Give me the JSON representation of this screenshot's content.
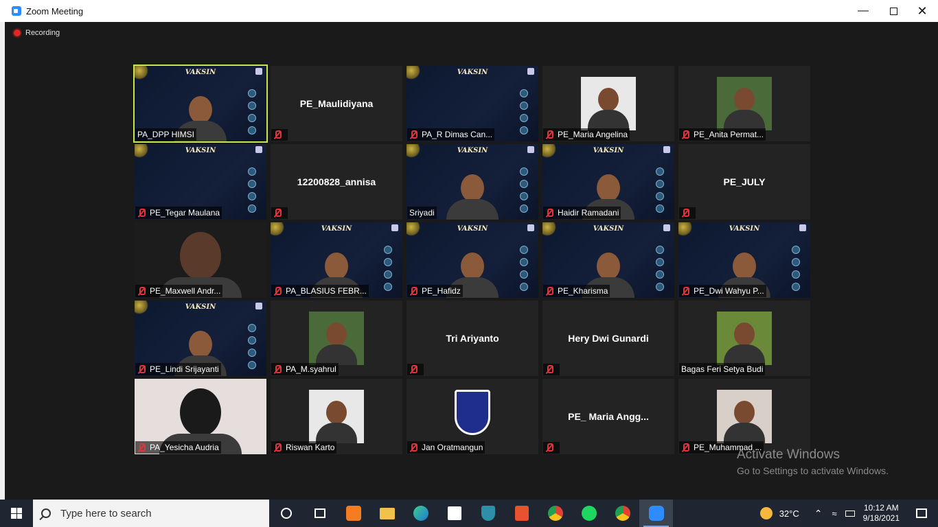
{
  "window": {
    "title": "Zoom Meeting"
  },
  "recording": {
    "label": "Recording"
  },
  "participants": [
    {
      "name": "PA_DPP HIMSI",
      "type": "slide-video",
      "muted": false,
      "active": true
    },
    {
      "name": "PE_Maulidiyana",
      "type": "name-only",
      "muted": true
    },
    {
      "name": "PA_R Dimas Can...",
      "type": "slide",
      "muted": true
    },
    {
      "name": "PE_Maria Angelina",
      "type": "photo",
      "muted": true
    },
    {
      "name": "PE_Anita Permat...",
      "type": "photo",
      "muted": true
    },
    {
      "name": "PE_Tegar Maulana",
      "type": "slide",
      "muted": true
    },
    {
      "name": "12200828_annisa",
      "type": "name-only",
      "muted": true
    },
    {
      "name": "Sriyadi",
      "type": "slide-video",
      "muted": false
    },
    {
      "name": "Haidir Ramadani",
      "type": "slide-video",
      "muted": true
    },
    {
      "name": "PE_JULY",
      "type": "name-only",
      "muted": true
    },
    {
      "name": "PE_Maxwell Andr...",
      "type": "video",
      "muted": true
    },
    {
      "name": "PA_BLASIUS FEBR...",
      "type": "slide-video",
      "muted": true
    },
    {
      "name": "PE_Hafidz",
      "type": "slide-video",
      "muted": true
    },
    {
      "name": "PE_Kharisma",
      "type": "slide-video",
      "muted": true
    },
    {
      "name": "PE_Dwi Wahyu P...",
      "type": "slide-video",
      "muted": true
    },
    {
      "name": "PE_Lindi Srijayanti",
      "type": "slide-video",
      "muted": true
    },
    {
      "name": "PA_M.syahrul",
      "type": "photo",
      "muted": true
    },
    {
      "name": "Tri Ariyanto",
      "type": "name-only",
      "muted": true
    },
    {
      "name": "Hery Dwi Gunardi",
      "type": "name-only",
      "muted": true
    },
    {
      "name": "Bagas Feri Setya Budi",
      "type": "photo",
      "muted": false
    },
    {
      "name": "PA_Yesicha Audria",
      "type": "video",
      "muted": true
    },
    {
      "name": "Riswan Karto",
      "type": "photo",
      "muted": true
    },
    {
      "name": "Jan Oratmangun",
      "type": "logo",
      "muted": true
    },
    {
      "name": "PE_ Maria Angg...",
      "type": "name-only",
      "muted": true
    },
    {
      "name": "PE_Muhammad ...",
      "type": "photo",
      "muted": true
    }
  ],
  "slide_title": "VAKSIN",
  "watermark": {
    "line1": "Activate Windows",
    "line2": "Go to Settings to activate Windows."
  },
  "taskbar": {
    "search_placeholder": "Type here to search",
    "temperature": "32°C",
    "time": "10:12 AM",
    "date": "9/18/2021"
  },
  "colors": {
    "active_speaker": "#c3e84b",
    "muted_icon": "#e0353a",
    "taskbar": "#1f2631"
  }
}
